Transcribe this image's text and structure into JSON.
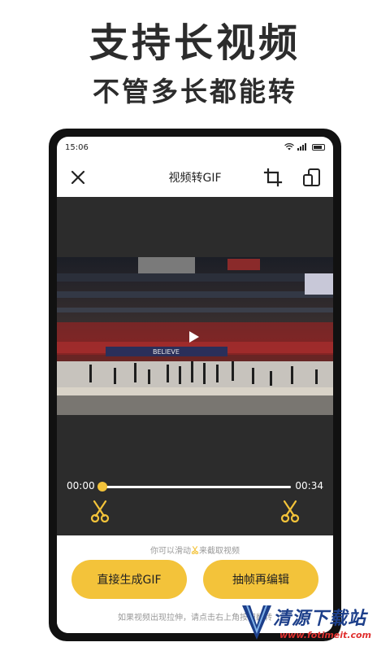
{
  "promo": {
    "title": "支持长视频",
    "subtitle": "不管多长都能转"
  },
  "status_bar": {
    "time": "15:06",
    "icons": [
      "wifi-icon",
      "signal-icon",
      "battery-icon"
    ]
  },
  "toolbar": {
    "title": "视频转GIF",
    "icons": [
      "close-icon",
      "crop-icon",
      "aspect-ratio-icon"
    ]
  },
  "video": {
    "banner_text": "BELIEVE",
    "progress_fraction": 0.0
  },
  "timeline": {
    "start_time": "00:00",
    "end_time": "00:34"
  },
  "bottom": {
    "hint": "你可以滑动",
    "hint_suffix": "来截取视频",
    "button_direct": "直接生成GIF",
    "button_frames": "抽帧再编辑",
    "note": "如果视频出现拉伸，请点击右上角按钮翻转"
  },
  "watermark": {
    "text": "清源下载站",
    "url": "www.fotimeit.com"
  },
  "colors": {
    "accent": "#f3c33a",
    "editor_bg": "#2c2c2c",
    "frame": "#111111"
  }
}
